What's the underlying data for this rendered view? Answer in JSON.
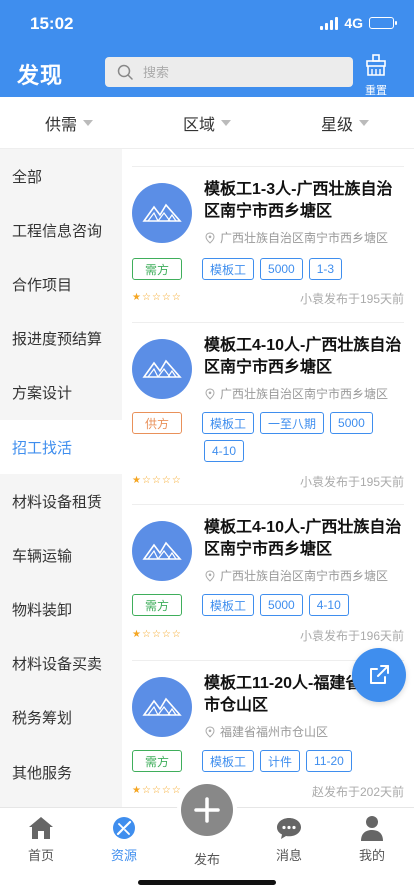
{
  "status": {
    "time": "15:02",
    "network": "4G"
  },
  "header": {
    "title": "发现",
    "search_placeholder": "搜索",
    "reset_label": "重置"
  },
  "filters": [
    {
      "label": "供需"
    },
    {
      "label": "区域"
    },
    {
      "label": "星级"
    }
  ],
  "sidebar": {
    "items": [
      {
        "label": "全部"
      },
      {
        "label": "工程信息咨询"
      },
      {
        "label": "合作项目"
      },
      {
        "label": "报进度预结算"
      },
      {
        "label": "方案设计"
      },
      {
        "label": "招工找活"
      },
      {
        "label": "材料设备租赁"
      },
      {
        "label": "车辆运输"
      },
      {
        "label": "物料装卸"
      },
      {
        "label": "材料设备买卖"
      },
      {
        "label": "税务筹划"
      },
      {
        "label": "其他服务"
      }
    ],
    "active_index": 5
  },
  "listings": [
    {
      "title": "模板工1-3人-广西壮族自治区南宁市西乡塘区",
      "location": "广西壮族自治区南宁市西乡塘区",
      "type": "需方",
      "tags": [
        "模板工",
        "5000",
        "1-3"
      ],
      "rating": 1,
      "meta": "小袁发布于195天前"
    },
    {
      "title": "模板工4-10人-广西壮族自治区南宁市西乡塘区",
      "location": "广西壮族自治区南宁市西乡塘区",
      "type": "供方",
      "tags": [
        "模板工",
        "一至八期",
        "5000",
        "4-10"
      ],
      "rating": 1,
      "meta": "小袁发布于195天前"
    },
    {
      "title": "模板工4-10人-广西壮族自治区南宁市西乡塘区",
      "location": "广西壮族自治区南宁市西乡塘区",
      "type": "需方",
      "tags": [
        "模板工",
        "5000",
        "4-10"
      ],
      "rating": 1,
      "meta": "小袁发布于196天前"
    },
    {
      "title": "模板工11-20人-福建省福州市仓山区",
      "location": "福建省福州市仓山区",
      "type": "需方",
      "tags": [
        "模板工",
        "计件",
        "11-20"
      ],
      "rating": 1,
      "meta": "赵发布于202天前"
    }
  ],
  "tabbar": {
    "items": [
      {
        "label": "首页",
        "icon": "home-icon"
      },
      {
        "label": "资源",
        "icon": "resource-icon"
      },
      {
        "label": "发布",
        "icon": "plus-icon"
      },
      {
        "label": "消息",
        "icon": "message-icon"
      },
      {
        "label": "我的",
        "icon": "profile-icon"
      }
    ],
    "active_index": 1
  },
  "colors": {
    "primary": "#3f8eee",
    "demand": "#3fae5b",
    "supply": "#e9915a",
    "star": "#f5a623"
  }
}
